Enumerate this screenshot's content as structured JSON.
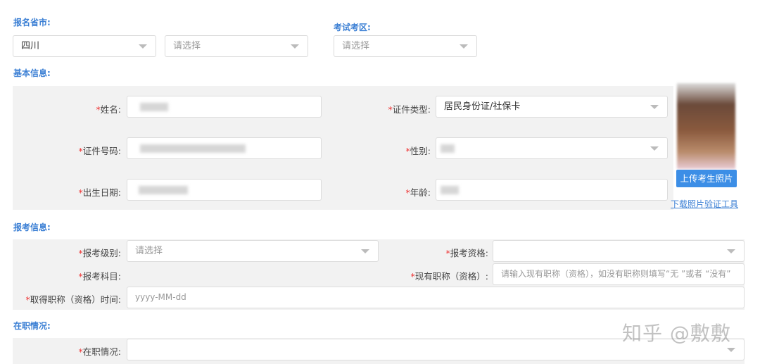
{
  "region": {
    "label": "报名省市:",
    "province": "四川",
    "city_placeholder": "请选择"
  },
  "exam_area": {
    "label": "考试考区:",
    "placeholder": "请选择"
  },
  "basic": {
    "title": "基本信息:",
    "name_label": "姓名:",
    "id_type_label": "证件类型:",
    "id_type_value": "居民身份证/社保卡",
    "id_no_label": "证件号码:",
    "gender_label": "性别:",
    "birth_label": "出生日期:",
    "age_label": "年龄:",
    "upload_button": "上传考生照片",
    "download_link": "下载照片验证工具",
    "required_mark": "*"
  },
  "exam": {
    "title": "报考信息:",
    "level_label": "报考级别:",
    "level_placeholder": "请选择",
    "qual_label": "报考资格:",
    "subject_label": "报考科目:",
    "title_label": "现有职称（资格）:",
    "title_placeholder": "请输入现有职称（资格），如没有职称则填写“无 ”或者 “没有”",
    "time_label": "取得职称（资格）时间:",
    "time_placeholder": "yyyy-MM-dd"
  },
  "job": {
    "title": "在职情况:",
    "status_label": "在职情况:"
  },
  "watermark": "知乎 @敷敷",
  "colors": {
    "accent": "#3b7fd4",
    "button": "#3c8ee6",
    "required": "#e33333"
  }
}
